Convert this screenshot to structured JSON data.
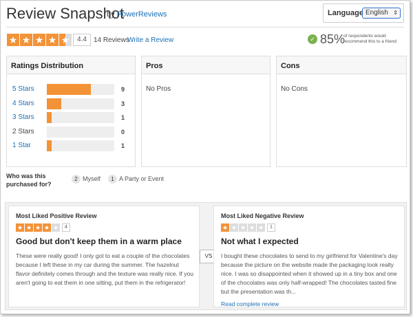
{
  "header": {
    "title": "Review Snapshot",
    "by": "by",
    "provider": "PowerReviews",
    "language_label": "Language",
    "language_value": "English"
  },
  "summary": {
    "rating_stars": 4.4,
    "rating": "4.4",
    "review_count": "14 Reviews",
    "write_review": "Write a Review",
    "recommend_pct": "85%",
    "recommend_text": "of respondents would recommend this to a friend",
    "accent_color": "#f39237",
    "check_color": "#7ab24e"
  },
  "distribution": {
    "heading": "Ratings Distribution",
    "rows": [
      {
        "label": "5 Stars",
        "count": "9",
        "value": 9
      },
      {
        "label": "4 Stars",
        "count": "3",
        "value": 3
      },
      {
        "label": "3 Stars",
        "count": "1",
        "value": 1
      },
      {
        "label": "2 Stars",
        "count": "0",
        "value": 0
      },
      {
        "label": "1 Star",
        "count": "1",
        "value": 1
      }
    ]
  },
  "pros": {
    "heading": "Pros",
    "text": "No Pros"
  },
  "cons": {
    "heading": "Cons",
    "text": "No Cons"
  },
  "purchased": {
    "label": "Who was this purchased for?",
    "chips": [
      {
        "count": "2",
        "label": "Myself"
      },
      {
        "count": "1",
        "label": "A Party or Event"
      }
    ]
  },
  "positive": {
    "title": "Most Liked Positive Review",
    "stars": 4,
    "rating": "4",
    "headline": "Good but don't keep them in a warm place",
    "body": "These were really good! I only got to eat a couple of the chocolates because I left these in my car during the summer. The hazelnut flavor definitely comes through and the texture was really nice. If you aren't going to eat them in one sitting, put them in the refrigerator!"
  },
  "vs": "VS",
  "negative": {
    "title": "Most Liked Negative Review",
    "stars": 1,
    "rating": "1",
    "headline": "Not what I expected",
    "body": "I bought these chocolates to send to my girlfriend for Valentine's day because the picture on the website made the packaging look really nice. I was so disappointed when it showed up in a tiny box and one of the chocolates was only half-wrapped! The chocolates tasted fine but the presentation was th...",
    "link": "Read complete review"
  }
}
